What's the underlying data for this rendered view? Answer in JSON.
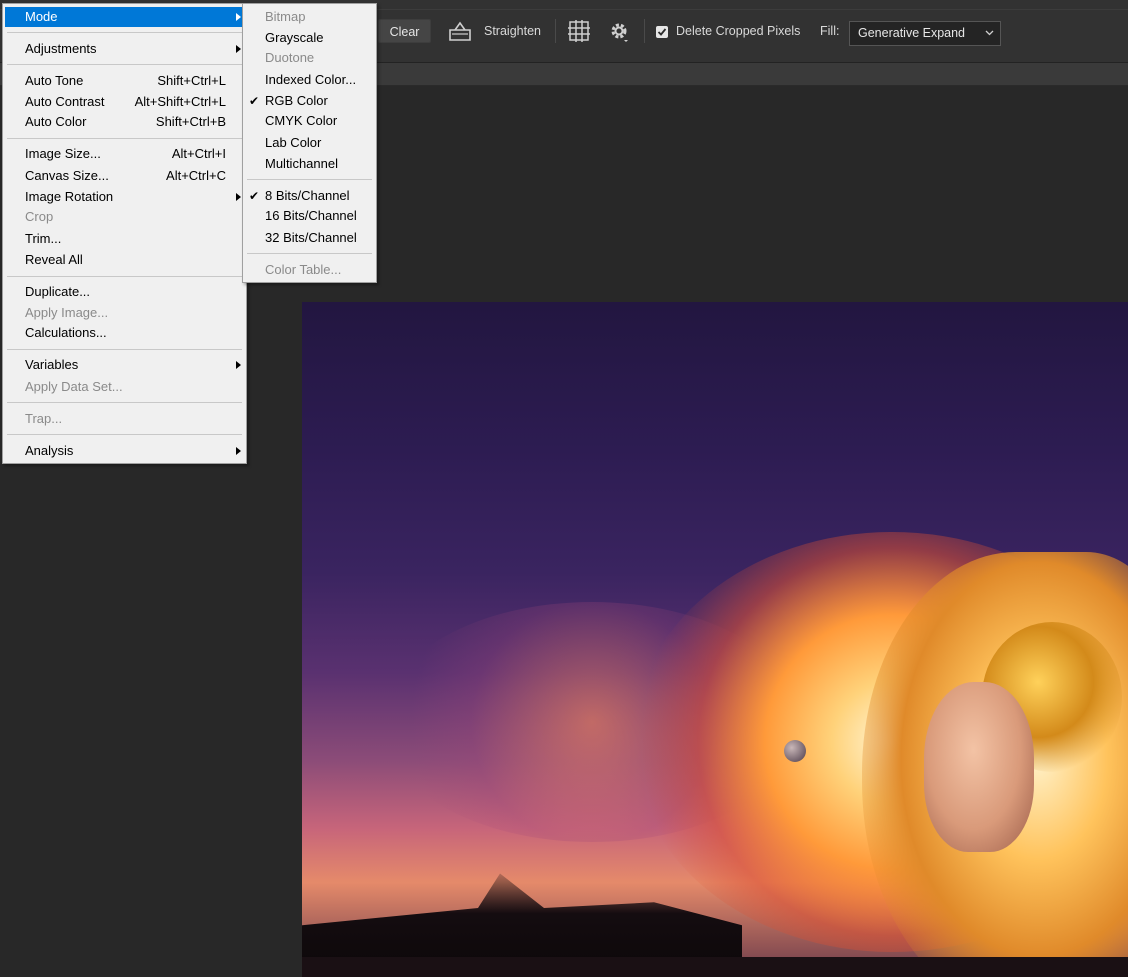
{
  "options_bar": {
    "clear_label": "Clear",
    "straighten_label": "Straighten",
    "delete_cropped_label": "Delete Cropped Pixels",
    "delete_cropped_checked": true,
    "fill_label": "Fill:",
    "fill_value": "Generative Expand"
  },
  "image_menu": {
    "items": [
      {
        "label": "Mode",
        "shortcut": "",
        "submenu": true,
        "highlighted": true
      },
      {
        "label": "Adjustments",
        "shortcut": "",
        "submenu": true
      },
      {
        "label": "Auto Tone",
        "shortcut": "Shift+Ctrl+L"
      },
      {
        "label": "Auto Contrast",
        "shortcut": "Alt+Shift+Ctrl+L"
      },
      {
        "label": "Auto Color",
        "shortcut": "Shift+Ctrl+B"
      },
      {
        "label": "Image Size...",
        "shortcut": "Alt+Ctrl+I"
      },
      {
        "label": "Canvas Size...",
        "shortcut": "Alt+Ctrl+C"
      },
      {
        "label": "Image Rotation",
        "shortcut": "",
        "submenu": true
      },
      {
        "label": "Crop",
        "shortcut": "",
        "disabled": true
      },
      {
        "label": "Trim...",
        "shortcut": ""
      },
      {
        "label": "Reveal All",
        "shortcut": ""
      },
      {
        "label": "Duplicate...",
        "shortcut": ""
      },
      {
        "label": "Apply Image...",
        "shortcut": "",
        "disabled": true
      },
      {
        "label": "Calculations...",
        "shortcut": ""
      },
      {
        "label": "Variables",
        "shortcut": "",
        "submenu": true
      },
      {
        "label": "Apply Data Set...",
        "shortcut": "",
        "disabled": true
      },
      {
        "label": "Trap...",
        "shortcut": "",
        "disabled": true
      },
      {
        "label": "Analysis",
        "shortcut": "",
        "submenu": true
      }
    ]
  },
  "mode_submenu": {
    "items": [
      {
        "label": "Bitmap",
        "disabled": true
      },
      {
        "label": "Grayscale"
      },
      {
        "label": "Duotone",
        "disabled": true
      },
      {
        "label": "Indexed Color..."
      },
      {
        "label": "RGB Color",
        "checked": true
      },
      {
        "label": "CMYK Color"
      },
      {
        "label": "Lab Color"
      },
      {
        "label": "Multichannel"
      },
      {
        "label": "8 Bits/Channel",
        "checked": true
      },
      {
        "label": "16 Bits/Channel"
      },
      {
        "label": "32 Bits/Channel"
      },
      {
        "label": "Color Table...",
        "disabled": true
      }
    ]
  },
  "colors": {
    "highlight": "#0078d7",
    "menu_bg": "#f0f0f0",
    "workspace_bg": "#282828",
    "toolbar_bg": "#323232"
  },
  "icons": [
    "straighten-icon",
    "grid-overlay-icon",
    "gear-icon",
    "checkbox-icon",
    "chevron-down-icon",
    "submenu-arrow-icon",
    "checkmark-icon"
  ]
}
